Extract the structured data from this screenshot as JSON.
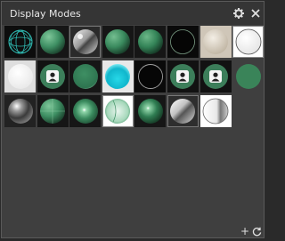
{
  "window": {
    "title": "Display Modes"
  },
  "toolbar": {
    "settings_icon": "gear-icon",
    "close_icon": "close-icon"
  },
  "footer": {
    "add_label": "+",
    "add_icon": "plus-icon",
    "refresh_icon": "refresh-icon"
  },
  "modes": [
    {
      "icon": "wireframe-sphere-icon"
    },
    {
      "icon": "shaded-green-sphere-icon"
    },
    {
      "icon": "chrome-sphere-icon"
    },
    {
      "icon": "shaded-green-sphere-icon"
    },
    {
      "icon": "shaded-green-sphere-icon"
    },
    {
      "icon": "outline-sphere-icon"
    },
    {
      "icon": "textured-sphere-icon"
    },
    {
      "icon": "white-sphere-icon"
    },
    {
      "icon": "white-flat-sphere-icon"
    },
    {
      "icon": "user-avatar-sphere-icon"
    },
    {
      "icon": "green-rim-sphere-icon"
    },
    {
      "icon": "cyan-glow-sphere-icon"
    },
    {
      "icon": "dark-outline-sphere-icon"
    },
    {
      "icon": "user-avatar-sphere-icon"
    },
    {
      "icon": "user-avatar-sphere-icon"
    },
    {
      "icon": "flat-green-circle-icon"
    },
    {
      "icon": "glossy-metal-sphere-icon"
    },
    {
      "icon": "gridded-green-sphere-icon"
    },
    {
      "icon": "specular-green-sphere-icon"
    },
    {
      "icon": "x-ray-sphere-icon"
    },
    {
      "icon": "shiny-green-sphere-icon"
    },
    {
      "icon": "silver-sphere-icon"
    },
    {
      "icon": "half-shaded-sphere-icon"
    }
  ]
}
